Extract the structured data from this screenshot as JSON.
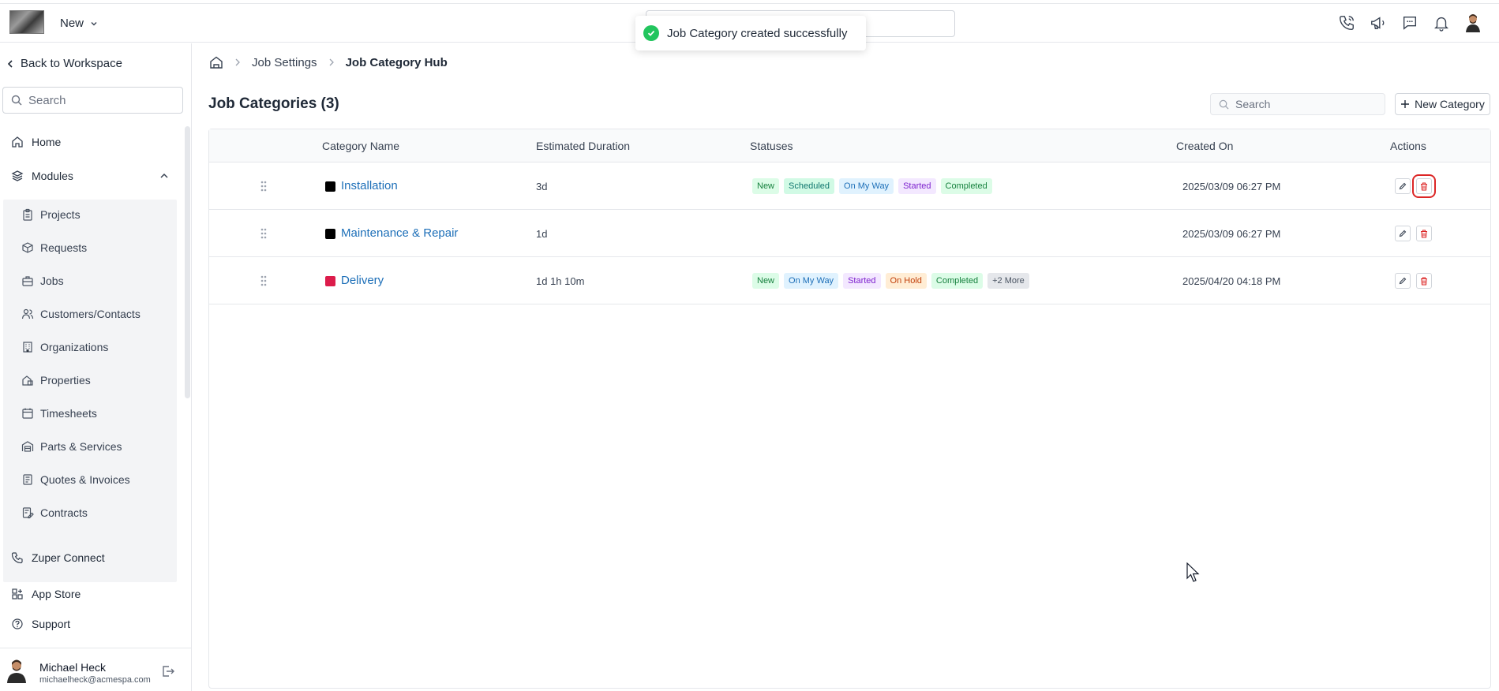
{
  "topbar": {
    "new_label": "New",
    "icons": [
      "phone-icon",
      "megaphone-icon",
      "chat-icon",
      "bell-icon",
      "user-avatar"
    ]
  },
  "toast": {
    "message": "Job Category created successfully"
  },
  "sidebar": {
    "back_label": "Back to Workspace",
    "search_placeholder": "Search",
    "home_label": "Home",
    "modules_label": "Modules",
    "modules": [
      {
        "label": "Projects",
        "icon": "clipboard-icon"
      },
      {
        "label": "Requests",
        "icon": "box-icon"
      },
      {
        "label": "Jobs",
        "icon": "briefcase-icon"
      },
      {
        "label": "Customers/Contacts",
        "icon": "users-icon"
      },
      {
        "label": "Organizations",
        "icon": "building-icon"
      },
      {
        "label": "Properties",
        "icon": "property-icon"
      },
      {
        "label": "Timesheets",
        "icon": "calendar-icon"
      },
      {
        "label": "Parts & Services",
        "icon": "warehouse-icon"
      },
      {
        "label": "Quotes & Invoices",
        "icon": "invoice-icon"
      },
      {
        "label": "Contracts",
        "icon": "contract-icon"
      }
    ],
    "bottom": [
      {
        "label": "Zuper Connect",
        "icon": "phone-icon"
      },
      {
        "label": "App Store",
        "icon": "apps-icon"
      },
      {
        "label": "Support",
        "icon": "help-icon"
      }
    ],
    "user": {
      "name": "Michael Heck",
      "email": "michaelheck@acmespa.com"
    }
  },
  "breadcrumb": {
    "items": [
      "Job Settings",
      "Job Category Hub"
    ]
  },
  "page": {
    "title": "Job Categories (3)",
    "search_placeholder": "Search",
    "new_button": "New Category"
  },
  "table": {
    "headers": {
      "name": "Category Name",
      "duration": "Estimated Duration",
      "statuses": "Statuses",
      "created": "Created On",
      "actions": "Actions"
    },
    "rows": [
      {
        "name": "Installation",
        "color": "#000000",
        "duration": "3d",
        "statuses": [
          "New",
          "Scheduled",
          "On My Way",
          "Started",
          "Completed"
        ],
        "created": "2025/03/09 06:27 PM"
      },
      {
        "name": "Maintenance & Repair",
        "color": "#000000",
        "duration": "1d",
        "statuses": [],
        "created": "2025/03/09 06:27 PM"
      },
      {
        "name": "Delivery",
        "color": "#dc1c4b",
        "duration": "1d 1h 10m",
        "statuses": [
          "New",
          "On My Way",
          "Started",
          "On Hold",
          "Completed",
          "+2 More"
        ],
        "created": "2025/04/20 04:18 PM"
      }
    ]
  },
  "colors": {
    "link": "#1d6fb8",
    "danger": "#dc2626",
    "success": "#22c55e"
  }
}
